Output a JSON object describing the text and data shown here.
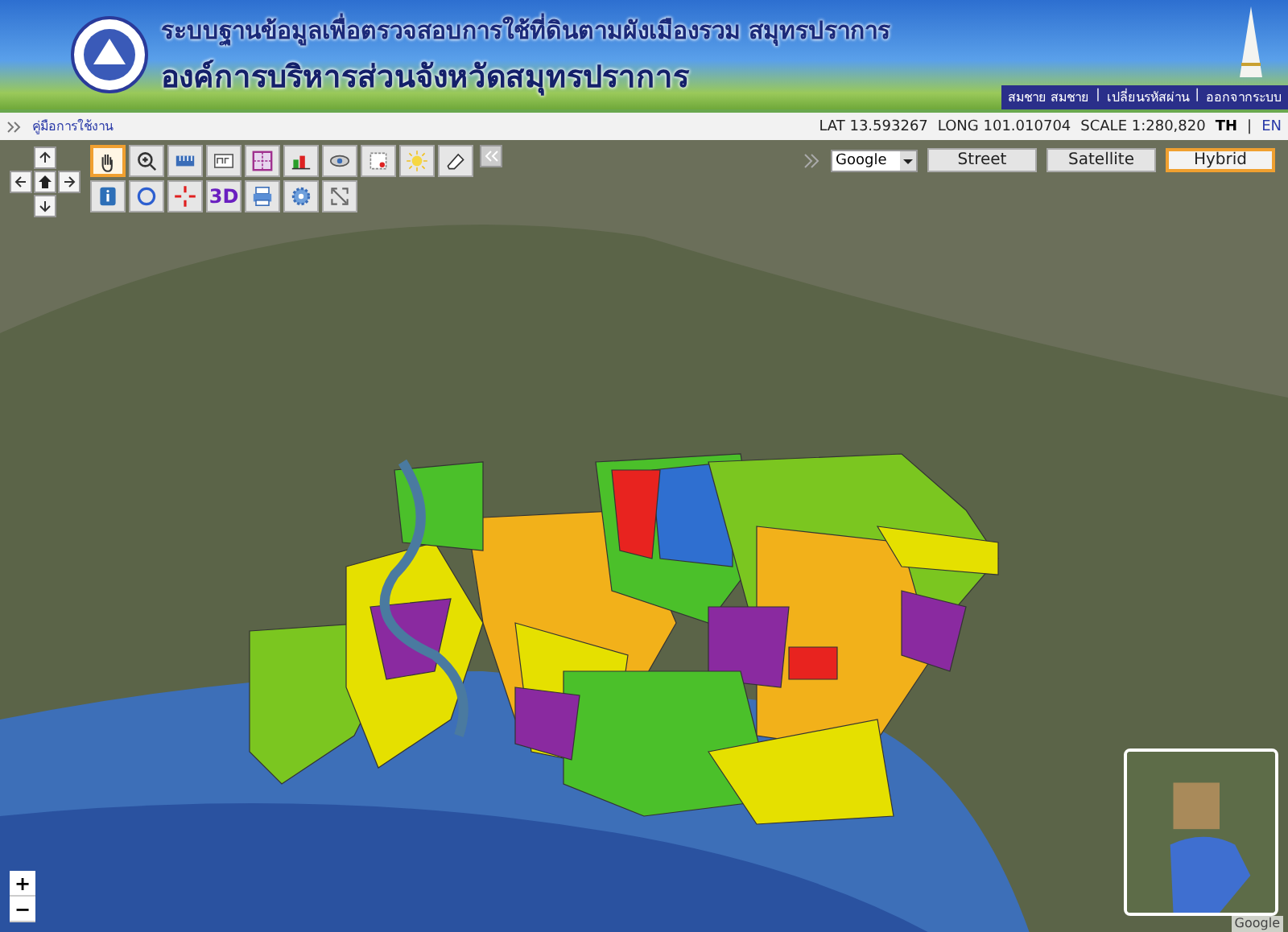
{
  "header": {
    "title": "ระบบฐานข้อมูลเพื่อตรวจสอบการใช้ที่ดินตามผังเมืองรวม สมุทรปราการ",
    "subtitle": "องค์การบริหารส่วนจังหวัดสมุทรปราการ",
    "user_links": [
      "สมชาย สมชาย",
      "เปลี่ยนรหัสผ่าน",
      "ออกจากระบบ"
    ],
    "separators": [
      "|",
      "|"
    ]
  },
  "info_bar": {
    "manual_link": "คู่มือการใช้งาน",
    "lat": "LAT 13.593267",
    "long": "LONG 101.010704",
    "scale": "SCALE 1:280,820",
    "language_separator": "|",
    "languages": [
      {
        "label": "TH",
        "selected": true
      },
      {
        "label": "EN",
        "selected": false
      }
    ]
  },
  "tools": [
    {
      "kind": "pan",
      "selected": true
    },
    {
      "kind": "zoom",
      "selected": false
    },
    {
      "kind": "measure",
      "selected": false
    },
    {
      "kind": "area",
      "selected": false
    },
    {
      "kind": "grid",
      "selected": false
    },
    {
      "kind": "chart",
      "selected": false
    },
    {
      "kind": "layers",
      "selected": false
    },
    {
      "kind": "select",
      "selected": false
    },
    {
      "kind": "light",
      "selected": false
    },
    {
      "kind": "eraser",
      "selected": false
    },
    {
      "kind": "info",
      "selected": false
    },
    {
      "kind": "circle",
      "selected": false
    },
    {
      "kind": "target",
      "selected": false
    },
    {
      "kind": "text",
      "label": "3D",
      "selected": false
    },
    {
      "kind": "print",
      "selected": false
    },
    {
      "kind": "settings",
      "selected": false
    },
    {
      "kind": "fullscreen",
      "selected": false
    }
  ],
  "map_source": {
    "value": "Google"
  },
  "map_types": [
    {
      "label": "Street",
      "selected": false
    },
    {
      "label": "Satellite",
      "selected": false
    },
    {
      "label": "Hybrid",
      "selected": true
    }
  ],
  "zoom": [
    "+",
    "−"
  ],
  "attribution": "Google"
}
